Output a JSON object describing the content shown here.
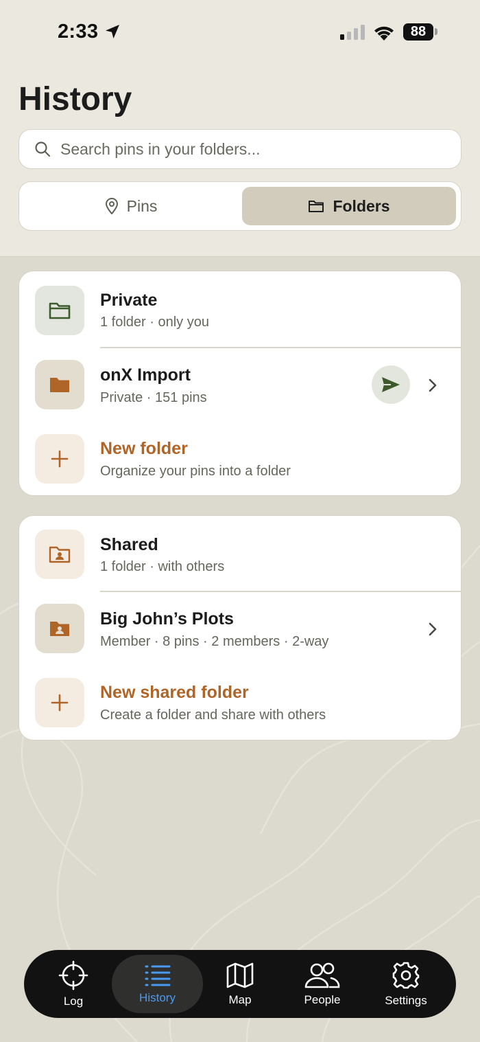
{
  "status_bar": {
    "time": "2:33",
    "battery": "88"
  },
  "header": {
    "title": "History"
  },
  "search": {
    "placeholder": "Search pins in your folders..."
  },
  "segmented": {
    "pins_label": "Pins",
    "folders_label": "Folders",
    "selected": "Folders"
  },
  "private_section": {
    "title": "Private",
    "subtitle": "1 folder · only you",
    "folders": [
      {
        "name": "onX Import",
        "meta": "Private · 151 pins"
      }
    ],
    "new_title": "New folder",
    "new_subtitle": "Organize your pins into a folder"
  },
  "shared_section": {
    "title": "Shared",
    "subtitle": "1 folder · with others",
    "folders": [
      {
        "name": "Big John’s Plots",
        "meta": "Member · 8 pins · 2 members · 2-way"
      }
    ],
    "new_title": "New shared folder",
    "new_subtitle": "Create a folder and share with others"
  },
  "tabbar": {
    "items": [
      {
        "label": "Log",
        "icon": "crosshair-icon"
      },
      {
        "label": "History",
        "icon": "list-icon"
      },
      {
        "label": "Map",
        "icon": "map-icon"
      },
      {
        "label": "People",
        "icon": "people-icon"
      },
      {
        "label": "Settings",
        "icon": "gear-icon"
      }
    ],
    "active": "History"
  },
  "colors": {
    "accent": "#b06528",
    "active_tab": "#4a9af3",
    "private_green": "#3d5a2c",
    "background": "#dcd9ce"
  }
}
